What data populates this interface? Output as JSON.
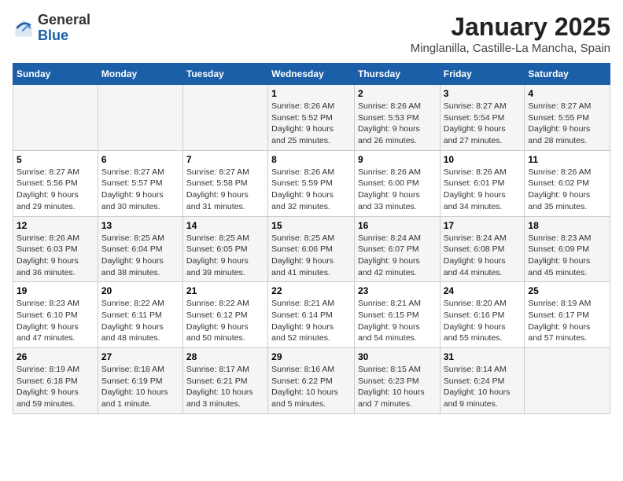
{
  "header": {
    "logo_general": "General",
    "logo_blue": "Blue",
    "title": "January 2025",
    "subtitle": "Minglanilla, Castille-La Mancha, Spain"
  },
  "weekdays": [
    "Sunday",
    "Monday",
    "Tuesday",
    "Wednesday",
    "Thursday",
    "Friday",
    "Saturday"
  ],
  "weeks": [
    [
      {
        "day": "",
        "info": ""
      },
      {
        "day": "",
        "info": ""
      },
      {
        "day": "",
        "info": ""
      },
      {
        "day": "1",
        "info": "Sunrise: 8:26 AM\nSunset: 5:52 PM\nDaylight: 9 hours\nand 25 minutes."
      },
      {
        "day": "2",
        "info": "Sunrise: 8:26 AM\nSunset: 5:53 PM\nDaylight: 9 hours\nand 26 minutes."
      },
      {
        "day": "3",
        "info": "Sunrise: 8:27 AM\nSunset: 5:54 PM\nDaylight: 9 hours\nand 27 minutes."
      },
      {
        "day": "4",
        "info": "Sunrise: 8:27 AM\nSunset: 5:55 PM\nDaylight: 9 hours\nand 28 minutes."
      }
    ],
    [
      {
        "day": "5",
        "info": "Sunrise: 8:27 AM\nSunset: 5:56 PM\nDaylight: 9 hours\nand 29 minutes."
      },
      {
        "day": "6",
        "info": "Sunrise: 8:27 AM\nSunset: 5:57 PM\nDaylight: 9 hours\nand 30 minutes."
      },
      {
        "day": "7",
        "info": "Sunrise: 8:27 AM\nSunset: 5:58 PM\nDaylight: 9 hours\nand 31 minutes."
      },
      {
        "day": "8",
        "info": "Sunrise: 8:26 AM\nSunset: 5:59 PM\nDaylight: 9 hours\nand 32 minutes."
      },
      {
        "day": "9",
        "info": "Sunrise: 8:26 AM\nSunset: 6:00 PM\nDaylight: 9 hours\nand 33 minutes."
      },
      {
        "day": "10",
        "info": "Sunrise: 8:26 AM\nSunset: 6:01 PM\nDaylight: 9 hours\nand 34 minutes."
      },
      {
        "day": "11",
        "info": "Sunrise: 8:26 AM\nSunset: 6:02 PM\nDaylight: 9 hours\nand 35 minutes."
      }
    ],
    [
      {
        "day": "12",
        "info": "Sunrise: 8:26 AM\nSunset: 6:03 PM\nDaylight: 9 hours\nand 36 minutes."
      },
      {
        "day": "13",
        "info": "Sunrise: 8:25 AM\nSunset: 6:04 PM\nDaylight: 9 hours\nand 38 minutes."
      },
      {
        "day": "14",
        "info": "Sunrise: 8:25 AM\nSunset: 6:05 PM\nDaylight: 9 hours\nand 39 minutes."
      },
      {
        "day": "15",
        "info": "Sunrise: 8:25 AM\nSunset: 6:06 PM\nDaylight: 9 hours\nand 41 minutes."
      },
      {
        "day": "16",
        "info": "Sunrise: 8:24 AM\nSunset: 6:07 PM\nDaylight: 9 hours\nand 42 minutes."
      },
      {
        "day": "17",
        "info": "Sunrise: 8:24 AM\nSunset: 6:08 PM\nDaylight: 9 hours\nand 44 minutes."
      },
      {
        "day": "18",
        "info": "Sunrise: 8:23 AM\nSunset: 6:09 PM\nDaylight: 9 hours\nand 45 minutes."
      }
    ],
    [
      {
        "day": "19",
        "info": "Sunrise: 8:23 AM\nSunset: 6:10 PM\nDaylight: 9 hours\nand 47 minutes."
      },
      {
        "day": "20",
        "info": "Sunrise: 8:22 AM\nSunset: 6:11 PM\nDaylight: 9 hours\nand 48 minutes."
      },
      {
        "day": "21",
        "info": "Sunrise: 8:22 AM\nSunset: 6:12 PM\nDaylight: 9 hours\nand 50 minutes."
      },
      {
        "day": "22",
        "info": "Sunrise: 8:21 AM\nSunset: 6:14 PM\nDaylight: 9 hours\nand 52 minutes."
      },
      {
        "day": "23",
        "info": "Sunrise: 8:21 AM\nSunset: 6:15 PM\nDaylight: 9 hours\nand 54 minutes."
      },
      {
        "day": "24",
        "info": "Sunrise: 8:20 AM\nSunset: 6:16 PM\nDaylight: 9 hours\nand 55 minutes."
      },
      {
        "day": "25",
        "info": "Sunrise: 8:19 AM\nSunset: 6:17 PM\nDaylight: 9 hours\nand 57 minutes."
      }
    ],
    [
      {
        "day": "26",
        "info": "Sunrise: 8:19 AM\nSunset: 6:18 PM\nDaylight: 9 hours\nand 59 minutes."
      },
      {
        "day": "27",
        "info": "Sunrise: 8:18 AM\nSunset: 6:19 PM\nDaylight: 10 hours\nand 1 minute."
      },
      {
        "day": "28",
        "info": "Sunrise: 8:17 AM\nSunset: 6:21 PM\nDaylight: 10 hours\nand 3 minutes."
      },
      {
        "day": "29",
        "info": "Sunrise: 8:16 AM\nSunset: 6:22 PM\nDaylight: 10 hours\nand 5 minutes."
      },
      {
        "day": "30",
        "info": "Sunrise: 8:15 AM\nSunset: 6:23 PM\nDaylight: 10 hours\nand 7 minutes."
      },
      {
        "day": "31",
        "info": "Sunrise: 8:14 AM\nSunset: 6:24 PM\nDaylight: 10 hours\nand 9 minutes."
      },
      {
        "day": "",
        "info": ""
      }
    ]
  ]
}
